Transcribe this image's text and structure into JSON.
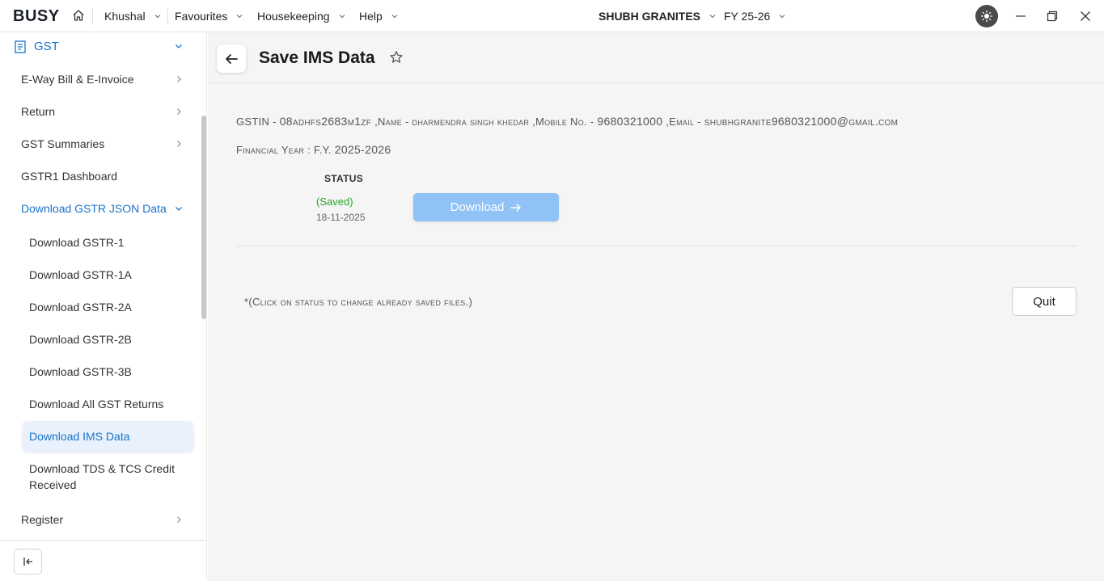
{
  "topbar": {
    "logo": "BUSY",
    "menus": [
      "Khushal",
      "Favourites",
      "Housekeeping",
      "Help"
    ],
    "company": "SHUBH GRANITES",
    "fy": "FY 25-26"
  },
  "sidebar": {
    "section": "GST",
    "items": [
      {
        "label": "E-Way Bill & E-Invoice"
      },
      {
        "label": "Return"
      },
      {
        "label": "GST Summaries"
      },
      {
        "label": "GSTR1 Dashboard"
      },
      {
        "label": "Download GSTR JSON Data"
      }
    ],
    "subitems": [
      {
        "label": "Download GSTR-1"
      },
      {
        "label": "Download GSTR-1A"
      },
      {
        "label": "Download GSTR-2A"
      },
      {
        "label": "Download GSTR-2B"
      },
      {
        "label": "Download GSTR-3B"
      },
      {
        "label": "Download All GST Returns"
      },
      {
        "label": "Download IMS Data"
      },
      {
        "label": "Download TDS & TCS Credit"
      },
      {
        "label": "Received"
      }
    ],
    "register": "Register"
  },
  "main": {
    "title": "Save IMS Data",
    "info": {
      "gstin_label": "GSTIN -",
      "gstin_value": "08adhfs2683m1zf",
      "name_label": ",Name -",
      "name_value": "DHARMENDRA SINGH KHEDAR",
      "mobile_label": ",Mobile No. -",
      "mobile_value": "9680321000",
      "email_label": ",Email -",
      "email_value": "shubhgranite9680321000@gmail.com",
      "fy_label": "Financial Year :",
      "fy_prefix": "F.Y.",
      "fy_value": "2025-2026"
    },
    "status_header": "STATUS",
    "status_value": "(Saved)",
    "status_date": "18-11-2025",
    "download_label": "Download",
    "note": "*(Click on status to change already saved files.)",
    "quit_label": "Quit"
  }
}
